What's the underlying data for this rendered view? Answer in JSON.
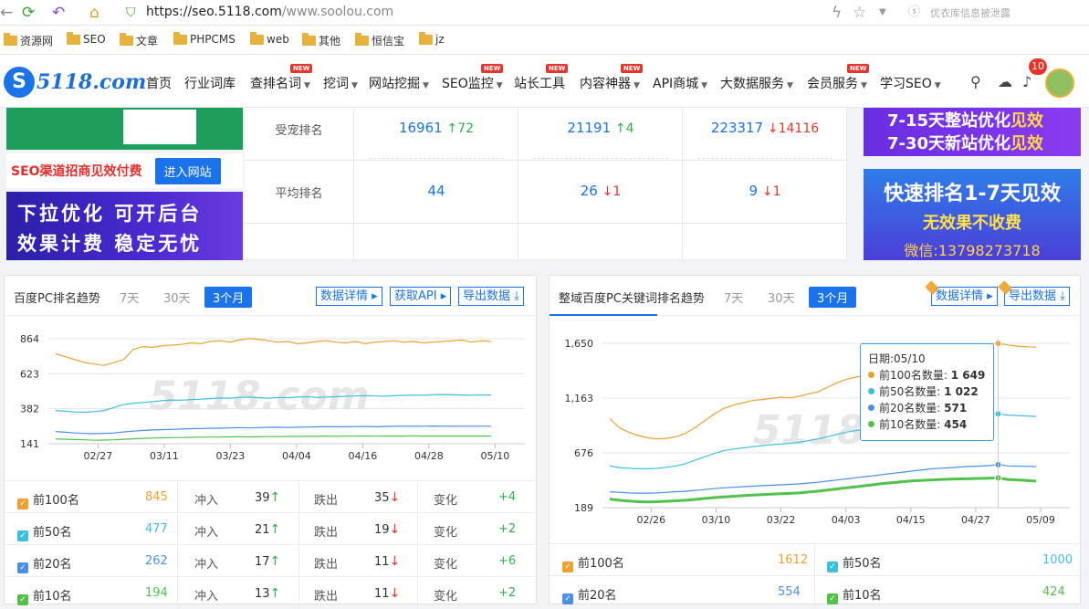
{
  "browser": {
    "url_host": "https://seo.5118.com",
    "url_path": "/www.soolou.com",
    "security_note": "优衣库信息被泄露",
    "bookmarks": [
      "资源网",
      "SEO",
      "文章",
      "PHPCMS",
      "web",
      "其他",
      "恒信宝",
      "jz"
    ]
  },
  "nav": {
    "logo_mark": "S",
    "logo_text": "5118.com",
    "new_badge": "NEW",
    "items": [
      "首页",
      "行业词库",
      "查排名词",
      "挖词",
      "网站挖掘",
      "SEO监控",
      "站长工具",
      "内容神器",
      "API商城",
      "大数据服务",
      "会员服务",
      "学习SEO"
    ],
    "notification_count": "10"
  },
  "left_banners": {
    "seo_text": "SEO渠道招商见效付费",
    "seo_button": "进入网站",
    "b3_line1": "下拉优化  可开后台",
    "b3_line2": "效果计费  稳定无忧"
  },
  "stats": {
    "rows": [
      {
        "label": "受宠排名",
        "values": [
          {
            "v": "16961",
            "d": "72",
            "dir": "up"
          },
          {
            "v": "21191",
            "d": "4",
            "dir": "up"
          },
          {
            "v": "223317",
            "d": "14116",
            "dir": "dn"
          }
        ]
      },
      {
        "label": "平均排名",
        "values": [
          {
            "v": "44",
            "d": "",
            "dir": ""
          },
          {
            "v": "26",
            "d": "1",
            "dir": "dn"
          },
          {
            "v": "9",
            "d": "1",
            "dir": "dn"
          }
        ]
      }
    ]
  },
  "right_banners": {
    "r1_line1a": "7-15天整站优化",
    "r1_line1b": "见效",
    "r1_line2a": "7-30天新站优化",
    "r1_line2b": "见效",
    "r2_line1": "快速排名1-7天见效",
    "r2_line2": "无效果不收费",
    "r2_line3": "微信:13798273718"
  },
  "left_panel": {
    "title": "百度PC排名趋势",
    "ranges": [
      "7天",
      "30天",
      "3个月"
    ],
    "btn_detail": "数据详情",
    "btn_api": "获取API",
    "btn_export": "导出数据",
    "watermark": "5118.com",
    "rows": [
      {
        "label": "前100名",
        "value": "845",
        "color": "#f0a030",
        "in_label": "冲入",
        "in": "39",
        "out_label": "跌出",
        "out": "35",
        "chg_label": "变化",
        "chg": "+4"
      },
      {
        "label": "前50名",
        "value": "477",
        "color": "#3cc0e0",
        "in_label": "冲入",
        "in": "21",
        "out_label": "跌出",
        "out": "19",
        "chg_label": "变化",
        "chg": "+2"
      },
      {
        "label": "前20名",
        "value": "262",
        "color": "#4a8fe8",
        "in_label": "冲入",
        "in": "17",
        "out_label": "跌出",
        "out": "11",
        "chg_label": "变化",
        "chg": "+6"
      },
      {
        "label": "前10名",
        "value": "194",
        "color": "#52c24a",
        "in_label": "冲入",
        "in": "13",
        "out_label": "跌出",
        "out": "11",
        "chg_label": "变化",
        "chg": "+2"
      }
    ]
  },
  "right_panel": {
    "title": "整域百度PC关键词排名趋势",
    "ranges": [
      "7天",
      "30天",
      "3个月"
    ],
    "btn_detail": "数据详情",
    "btn_export": "导出数据",
    "watermark": "5118",
    "tooltip": {
      "date": "日期:05/10",
      "items": [
        {
          "label": "前100名数量:",
          "value": "1 649",
          "color": "#f0a030"
        },
        {
          "label": "前50名数量:",
          "value": "1 022",
          "color": "#3cc0e0"
        },
        {
          "label": "前20名数量:",
          "value": "571",
          "color": "#4a8fe8"
        },
        {
          "label": "前10名数量:",
          "value": "454",
          "color": "#52c24a"
        }
      ]
    },
    "legend": [
      {
        "label": "前100名",
        "value": "1612",
        "color": "#f0a030"
      },
      {
        "label": "前50名",
        "value": "1000",
        "color": "#3cc0e0"
      },
      {
        "label": "前20名",
        "value": "554",
        "color": "#4a8fe8"
      },
      {
        "label": "前10名",
        "value": "424",
        "color": "#52c24a"
      }
    ]
  },
  "chart_data": [
    {
      "type": "line",
      "title": "百度PC排名趋势",
      "x_ticks": [
        "02/27",
        "03/11",
        "03/23",
        "04/04",
        "04/16",
        "04/28",
        "05/10"
      ],
      "y_ticks": [
        141,
        382,
        623,
        864
      ],
      "ylim": [
        141,
        864
      ],
      "series": [
        {
          "name": "前100名",
          "color": "#f0a030",
          "values": [
            760,
            740,
            720,
            700,
            690,
            680,
            700,
            720,
            790,
            810,
            805,
            815,
            820,
            825,
            835,
            830,
            845,
            850,
            840,
            855,
            865,
            860,
            850,
            840,
            845,
            830,
            835,
            845,
            850,
            840,
            835,
            845,
            830,
            840,
            845,
            850,
            840,
            845,
            835,
            840,
            845,
            850,
            855,
            840,
            850,
            845
          ]
        },
        {
          "name": "前50名",
          "color": "#3cc0e0",
          "values": [
            370,
            365,
            360,
            358,
            362,
            370,
            390,
            410,
            420,
            425,
            430,
            438,
            442,
            440,
            445,
            448,
            452,
            456,
            455,
            460,
            462,
            458,
            455,
            460,
            458,
            462,
            465,
            460,
            462,
            465,
            468,
            470,
            472,
            470,
            468,
            472,
            474,
            476,
            475,
            478,
            480,
            478,
            477,
            476,
            477,
            477
          ]
        },
        {
          "name": "前20名",
          "color": "#4a8fe8",
          "values": [
            225,
            220,
            215,
            212,
            210,
            212,
            215,
            222,
            228,
            232,
            236,
            238,
            240,
            242,
            245,
            246,
            248,
            248,
            250,
            252,
            250,
            252,
            254,
            255,
            253,
            255,
            256,
            257,
            258,
            257,
            258,
            259,
            260,
            258,
            260,
            261,
            262,
            261,
            262,
            263,
            262,
            261,
            262,
            262,
            262,
            262
          ]
        },
        {
          "name": "前10名",
          "color": "#52c24a",
          "values": [
            175,
            172,
            170,
            168,
            165,
            166,
            168,
            172,
            175,
            178,
            180,
            182,
            183,
            184,
            185,
            186,
            187,
            187,
            188,
            189,
            188,
            189,
            190,
            190,
            191,
            191,
            192,
            192,
            193,
            192,
            193,
            193,
            194,
            193,
            194,
            194,
            194,
            195,
            194,
            194,
            194,
            194,
            194,
            194,
            194,
            194
          ]
        }
      ]
    },
    {
      "type": "line",
      "title": "整域百度PC关键词排名趋势",
      "x_ticks": [
        "02/26",
        "03/10",
        "03/22",
        "04/03",
        "04/15",
        "04/27",
        "05/09"
      ],
      "y_ticks": [
        189,
        676,
        1163,
        1650
      ],
      "ylim": [
        189,
        1650
      ],
      "series": [
        {
          "name": "前100名",
          "color": "#f0a030",
          "values": [
            980,
            900,
            860,
            830,
            810,
            800,
            805,
            820,
            850,
            900,
            960,
            1020,
            1070,
            1100,
            1120,
            1140,
            1150,
            1160,
            1170,
            1165,
            1180,
            1200,
            1220,
            1260,
            1300,
            1330,
            1350,
            1370,
            1390,
            1420,
            1450,
            1470,
            1490,
            1510,
            1530,
            1550,
            1570,
            1590,
            1610,
            1630,
            1640,
            1649,
            1635,
            1625,
            1620,
            1615
          ]
        },
        {
          "name": "前50名",
          "color": "#3cc0e0",
          "values": [
            560,
            545,
            540,
            535,
            535,
            540,
            548,
            560,
            580,
            610,
            640,
            670,
            695,
            710,
            720,
            730,
            740,
            748,
            755,
            760,
            770,
            785,
            800,
            820,
            840,
            860,
            875,
            890,
            905,
            920,
            935,
            950,
            960,
            970,
            980,
            990,
            995,
            1000,
            1005,
            1010,
            1015,
            1022,
            1012,
            1008,
            1004,
            1000
          ]
        },
        {
          "name": "前20名",
          "color": "#4a8fe8",
          "values": [
            330,
            325,
            320,
            318,
            318,
            320,
            325,
            330,
            335,
            342,
            350,
            358,
            365,
            370,
            375,
            380,
            385,
            388,
            392,
            396,
            400,
            408,
            415,
            425,
            435,
            445,
            455,
            465,
            475,
            485,
            495,
            505,
            515,
            525,
            535,
            540,
            545,
            550,
            555,
            558,
            562,
            571,
            560,
            558,
            556,
            554
          ]
        },
        {
          "name": "前10名",
          "color": "#52c24a",
          "values": [
            265,
            255,
            248,
            242,
            240,
            242,
            246,
            250,
            255,
            262,
            270,
            278,
            285,
            290,
            295,
            300,
            305,
            308,
            312,
            316,
            320,
            328,
            336,
            345,
            355,
            365,
            375,
            385,
            395,
            405,
            412,
            420,
            428,
            432,
            436,
            440,
            442,
            445,
            447,
            449,
            450,
            454,
            440,
            436,
            430,
            424
          ]
        }
      ]
    }
  ]
}
